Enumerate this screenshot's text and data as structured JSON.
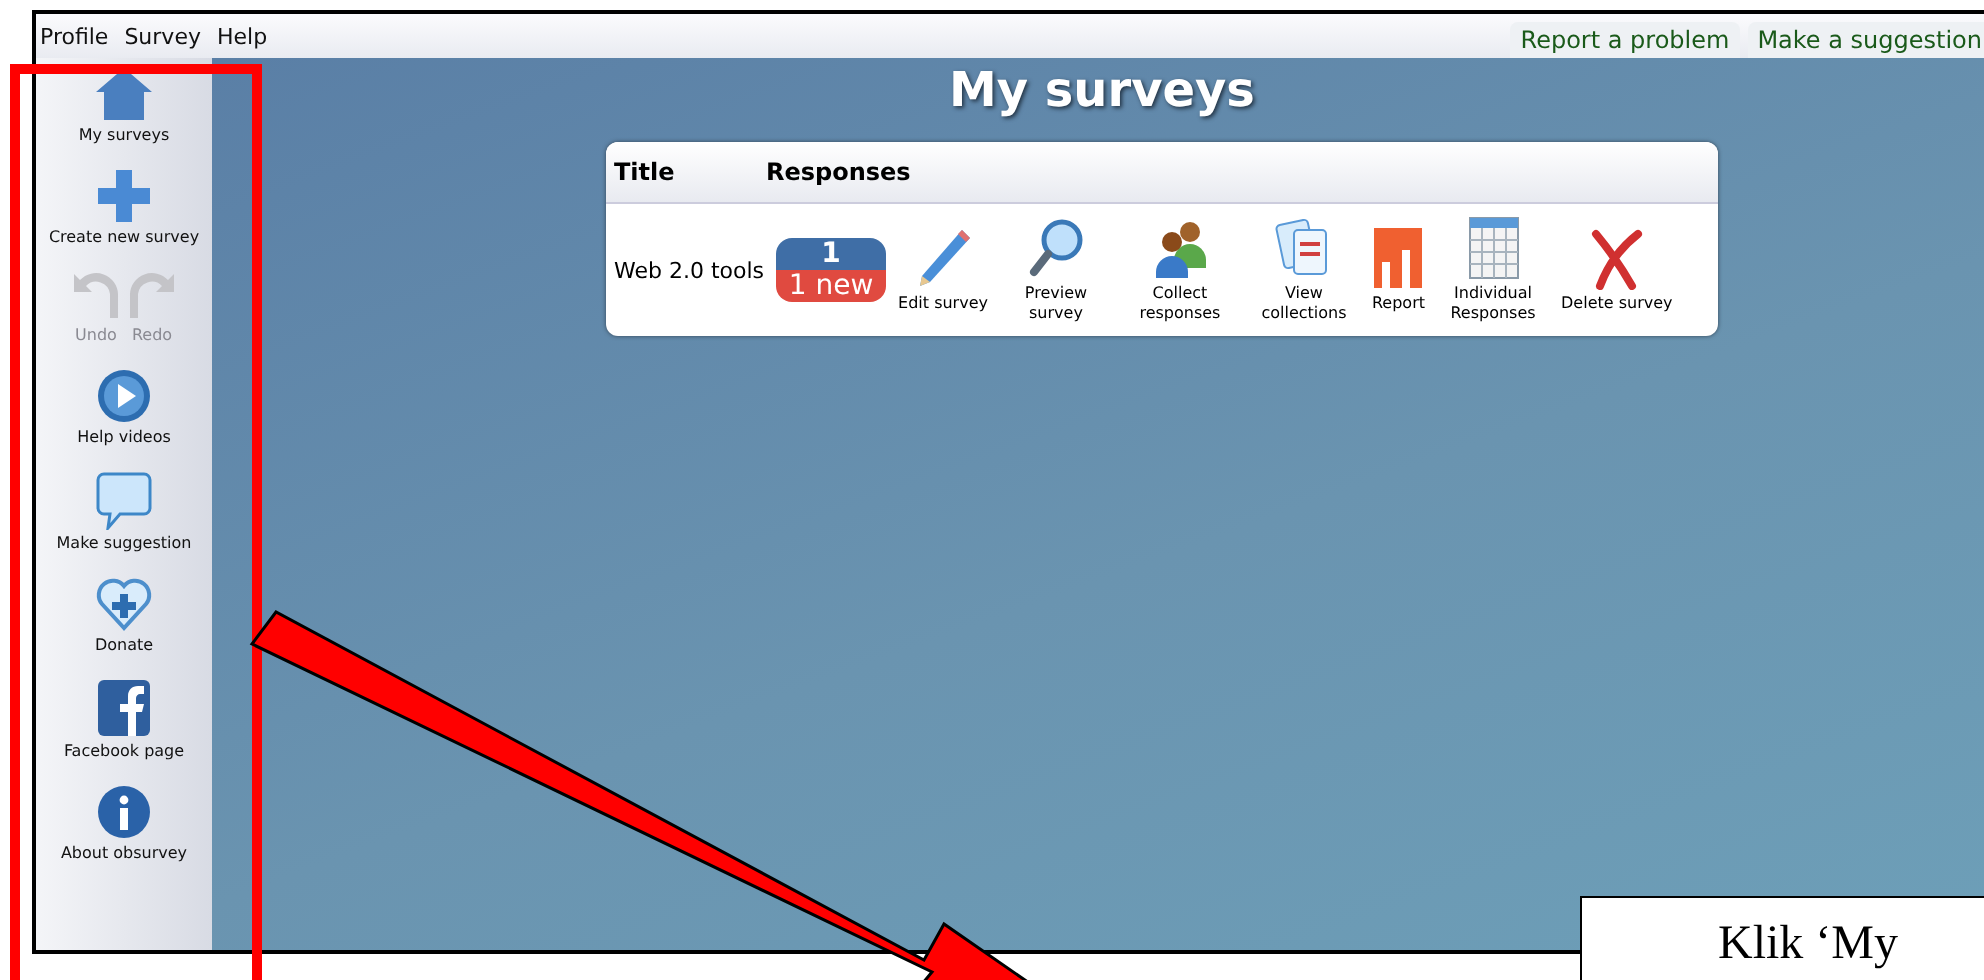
{
  "menu": [
    "Profile",
    "Survey",
    "Help"
  ],
  "top_links": [
    "Report a problem",
    "Make a suggestion"
  ],
  "sidebar": {
    "items": [
      {
        "kind": "single",
        "label": "My surveys",
        "disabled": false
      },
      {
        "kind": "single",
        "label": "Create new survey",
        "disabled": false
      },
      {
        "kind": "pair",
        "items": [
          {
            "label": "Undo",
            "disabled": true
          },
          {
            "label": "Redo",
            "disabled": true
          }
        ]
      },
      {
        "kind": "single",
        "label": "Help videos",
        "disabled": false
      },
      {
        "kind": "single",
        "label": "Make suggestion",
        "disabled": false
      },
      {
        "kind": "single",
        "label": "Donate",
        "disabled": false
      },
      {
        "kind": "single",
        "label": "Facebook page",
        "disabled": false
      },
      {
        "kind": "single",
        "label": "About obsurvey",
        "disabled": false
      }
    ]
  },
  "page_title": "My surveys",
  "table": {
    "columns": [
      "Title",
      "Responses"
    ],
    "rows": [
      {
        "title": "Web 2.0 tools",
        "responses": "1",
        "new_responses": "1 new",
        "actions": [
          "Edit survey",
          "Preview survey",
          "Collect responses",
          "View collections",
          "Report",
          "Individual Responses",
          "Delete survey"
        ]
      }
    ]
  },
  "note": {
    "text": "Klik ‘My"
  }
}
